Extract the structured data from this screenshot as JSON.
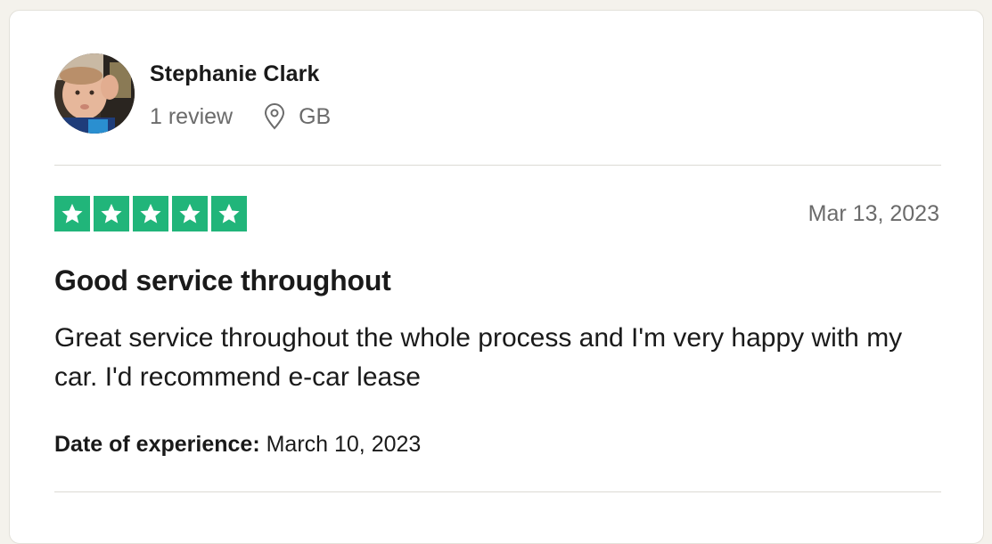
{
  "consumer": {
    "name": "Stephanie Clark",
    "review_count": "1 review",
    "location": "GB"
  },
  "review": {
    "rating": 5,
    "rating_max": 5,
    "date": "Mar 13, 2023",
    "title": "Good service throughout",
    "body": "Great service throughout the whole process and I'm very happy with my car. I'd recommend e-car lease",
    "experience_label": "Date of experience:",
    "experience_date": "March 10, 2023"
  },
  "colors": {
    "star_green": "#21b57a",
    "muted_text": "#6b6b6b"
  },
  "icons": {
    "location": "map-pin-icon",
    "star": "star-icon"
  }
}
